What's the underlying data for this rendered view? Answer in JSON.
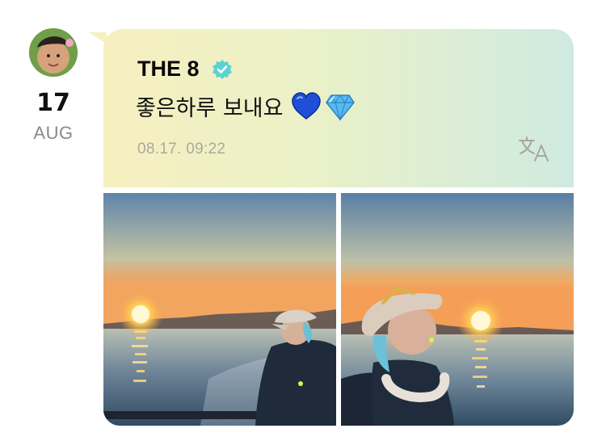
{
  "post": {
    "date_day": "17",
    "date_month": "AUG",
    "author": "THE 8",
    "message": "좋은하루 보내요",
    "timestamp": "08.17. 09:22"
  },
  "icons": {
    "verified": "verified-badge-icon",
    "heart": "blue-heart-icon",
    "gem": "gem-icon",
    "translate": "translate-icon"
  },
  "colors": {
    "bubble_start": "#f7f0c0",
    "bubble_end": "#cfeae0",
    "verified": "#5fd1d3",
    "timestamp": "#a9a9a0"
  }
}
